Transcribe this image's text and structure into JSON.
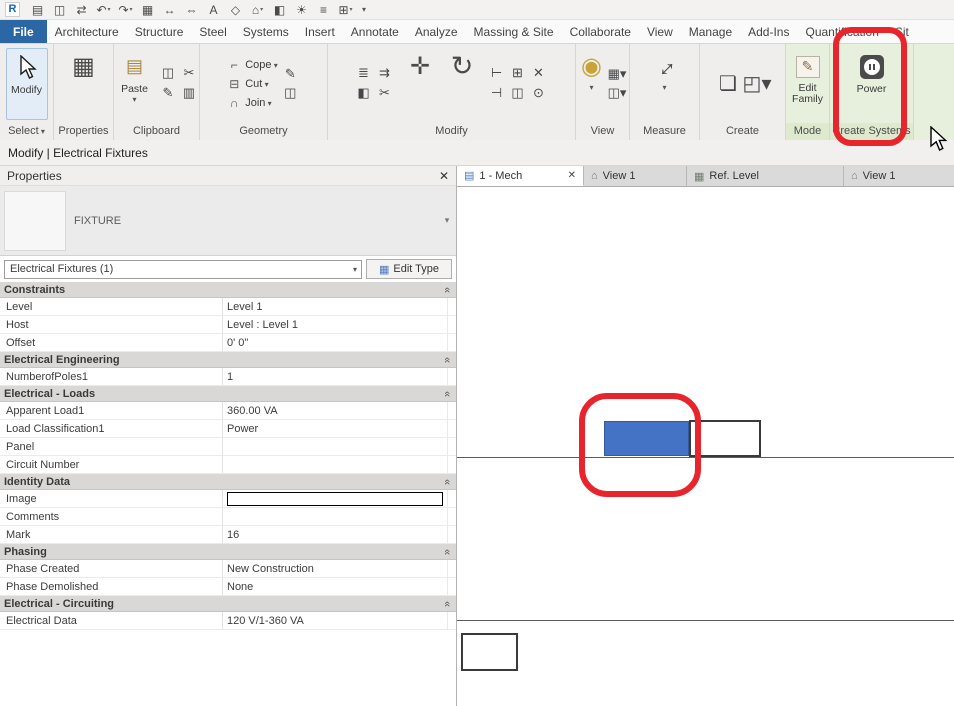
{
  "colors": {
    "accent_blue": "#2a67a4",
    "contextual_green": "#e7f0dc",
    "selection_blue": "#4472c4",
    "annotation_red": "#e8242c"
  },
  "qat": {
    "logo": "R",
    "icons": [
      [
        "open-file-icon",
        "▤",
        false
      ],
      [
        "save-icon",
        "◫",
        false
      ],
      [
        "sync-icon",
        "⇄",
        false
      ],
      [
        "undo-icon",
        "↶",
        true
      ],
      [
        "redo-icon",
        "↷",
        true
      ],
      [
        "print-icon",
        "▦",
        false
      ],
      [
        "measure-icon",
        "↔",
        false
      ],
      [
        "aligned-dimension-icon",
        "⇔",
        false
      ],
      [
        "text-icon",
        "A",
        false
      ],
      [
        "tag-icon",
        "◇",
        false
      ],
      [
        "default-3d-view-icon",
        "⌂",
        true
      ],
      [
        "section-icon",
        "◧",
        false
      ],
      [
        "sun-path-icon",
        "☀",
        false
      ],
      [
        "thin-lines-icon",
        "≡",
        false
      ],
      [
        "switch-windows-icon",
        "⊞",
        true
      ]
    ],
    "overflow": "▾"
  },
  "ribbon_tabs": [
    {
      "label": "File",
      "file": true
    },
    {
      "label": "Architecture"
    },
    {
      "label": "Structure"
    },
    {
      "label": "Steel"
    },
    {
      "label": "Systems"
    },
    {
      "label": "Insert"
    },
    {
      "label": "Annotate"
    },
    {
      "label": "Analyze"
    },
    {
      "label": "Massing & Site"
    },
    {
      "label": "Collaborate"
    },
    {
      "label": "View"
    },
    {
      "label": "Manage"
    },
    {
      "label": "Add-Ins"
    },
    {
      "label": "Quantification"
    },
    {
      "label": "Sit"
    }
  ],
  "ribbon": {
    "select_panel": {
      "label": "Select",
      "modify": "Modify"
    },
    "properties_panel": {
      "label": "Properties"
    },
    "clipboard_panel": {
      "label": "Clipboard",
      "paste": "Paste",
      "icons": [
        [
          "copy-to-clipboard-icon",
          "◫",
          false
        ],
        [
          "cut-to-clipboard-icon",
          "✂",
          false
        ],
        [
          "match-type-icon",
          "✎",
          false
        ],
        [
          "paste-options-icon",
          "▥",
          false
        ]
      ]
    },
    "geometry_panel": {
      "label": "Geometry",
      "cope": "Cope",
      "cope_icon": "⌐",
      "cut": "Cut",
      "cut_icon": "⊟",
      "join": "Join",
      "join_icon": "∩",
      "side_icons": [
        [
          "apply-coping-icon",
          "✎",
          false
        ],
        [
          "wall-joins-icon",
          "◫",
          false
        ]
      ]
    },
    "modify_panel": {
      "label": "Modify",
      "move_icon": "✛",
      "rotate_icon": "↻",
      "left_icons": [
        [
          "align-icon",
          "≣",
          false
        ],
        [
          "offset-icon",
          "⇉",
          false
        ],
        [
          "mirror-icon",
          "◧",
          false
        ],
        [
          "split-icon",
          "✂",
          false
        ]
      ],
      "right_icons": [
        [
          "trim-extend-icon",
          "⊢",
          false
        ],
        [
          "array-icon",
          "⊞",
          false
        ],
        [
          "delete-icon",
          "✕",
          false
        ],
        [
          "extend-icon",
          "⊣",
          false
        ],
        [
          "copy-icon",
          "◫",
          false
        ],
        [
          "pin-icon",
          "⊙",
          false
        ]
      ]
    },
    "view_panel": {
      "label": "View",
      "big_icon": "◉",
      "side_icons": [
        [
          "visibility-graphics-icon",
          "▦",
          true
        ],
        [
          "hide-elements-icon",
          "◫",
          true
        ]
      ]
    },
    "measure_panel": {
      "label": "Measure",
      "icon": "↔"
    },
    "create_panel": {
      "label": "Create",
      "icons": [
        [
          "create-parts-icon",
          "❏",
          false
        ],
        [
          "create-assembly-icon",
          "◰",
          true
        ]
      ]
    },
    "mode_panel": {
      "label": "Mode",
      "edit_family": "Edit Family",
      "icon": "✎"
    },
    "create_systems_panel": {
      "label": "Create Systems",
      "power": "Power"
    }
  },
  "context_bar": {
    "text": "Modify | Electrical Fixtures"
  },
  "properties_panel": {
    "title": "Properties",
    "type_name": "FIXTURE",
    "selector": "Electrical Fixtures (1)",
    "edit_type": "Edit Type",
    "groups": [
      {
        "name": "Constraints",
        "rows": [
          {
            "label": "Level",
            "value": "Level 1"
          },
          {
            "label": "Host",
            "value": "Level : Level 1"
          },
          {
            "label": "Offset",
            "value": "0' 0\""
          }
        ]
      },
      {
        "name": "Electrical Engineering",
        "rows": [
          {
            "label": "NumberofPoles1",
            "value": "1"
          }
        ]
      },
      {
        "name": "Electrical - Loads",
        "rows": [
          {
            "label": "Apparent Load1",
            "value": "360.00 VA"
          },
          {
            "label": "Load Classification1",
            "value": "Power"
          },
          {
            "label": "Panel",
            "value": ""
          },
          {
            "label": "Circuit Number",
            "value": ""
          }
        ]
      },
      {
        "name": "Identity Data",
        "rows": [
          {
            "label": "Image",
            "value": "",
            "input": true
          },
          {
            "label": "Comments",
            "value": ""
          },
          {
            "label": "Mark",
            "value": "16"
          }
        ]
      },
      {
        "name": "Phasing",
        "rows": [
          {
            "label": "Phase Created",
            "value": "New Construction"
          },
          {
            "label": "Phase Demolished",
            "value": "None"
          }
        ]
      },
      {
        "name": "Electrical - Circuiting",
        "rows": [
          {
            "label": "Electrical Data",
            "value": "120 V/1-360 VA"
          }
        ]
      }
    ]
  },
  "view_tabs": [
    {
      "label": "1 - Mech",
      "icon": "mech-plan-view-icon",
      "glyph": "▤",
      "active": true,
      "closable": true
    },
    {
      "label": "View 1",
      "icon": "3d-view-icon",
      "glyph": "⌂"
    },
    {
      "label": "Ref. Level",
      "icon": "plan-view-icon",
      "glyph": "▦"
    },
    {
      "label": "View 1",
      "icon": "3d-view-icon",
      "glyph": "⌂"
    }
  ]
}
